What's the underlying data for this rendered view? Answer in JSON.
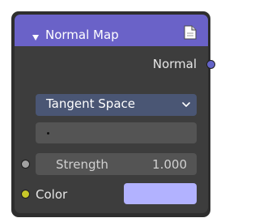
{
  "node": {
    "title": "Normal Map",
    "header_color": "#6a62c8",
    "output": {
      "label": "Normal",
      "socket_color": "#6363c7"
    },
    "space_dropdown": {
      "selected": "Tangent Space",
      "icon": "chevron-down-icon"
    },
    "uv_map_field": {
      "value": ""
    },
    "strength": {
      "label": "Strength",
      "value": "1.000",
      "socket_color": "#a1a1a1"
    },
    "color": {
      "label": "Color",
      "swatch_color": "#b2b2ff",
      "socket_color": "#c7c729"
    },
    "icons": {
      "collapse": "collapse-triangle-icon",
      "preview": "preview-toggle-icon"
    }
  }
}
